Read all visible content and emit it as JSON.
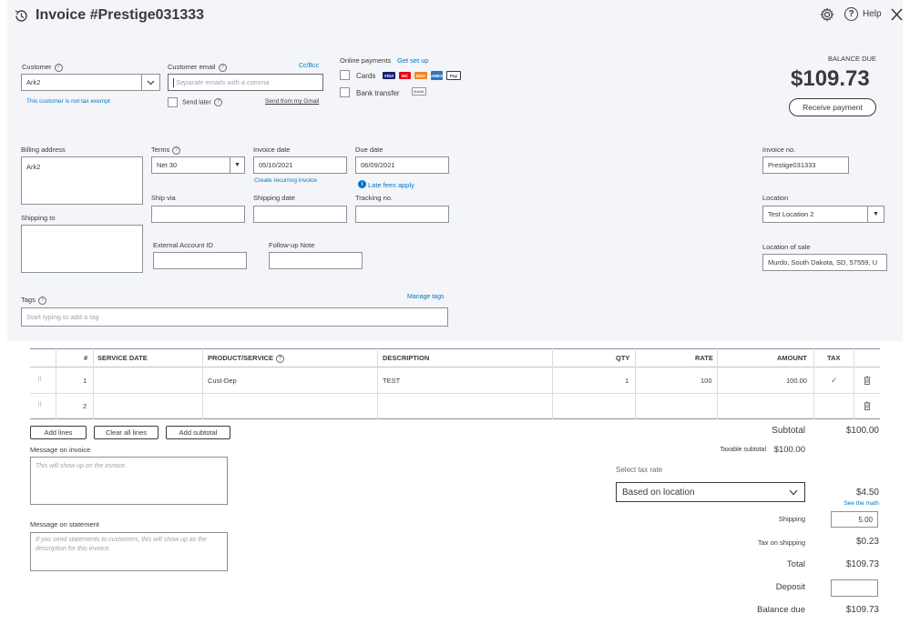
{
  "header": {
    "title": "Invoice #Prestige031333",
    "help_label": "Help"
  },
  "customer": {
    "label": "Customer",
    "value": "Ark2",
    "tax_note": "This customer is not tax exempt"
  },
  "email": {
    "label": "Customer email",
    "ccbcc": "Cc/Bcc",
    "placeholder": "Separate emails with a comma",
    "send_later": "Send later",
    "send_gmail": "Send from my Gmail"
  },
  "online_payments": {
    "label": "Online payments",
    "setup": "Get set up",
    "cards": "Cards",
    "bank": "Bank transfer",
    "card_logos": [
      "VISA",
      "MC",
      "DISC",
      "AMEX",
      "Pay"
    ],
    "bank_logo": "BANK"
  },
  "balance": {
    "label": "BALANCE DUE",
    "amount": "$109.73",
    "receive_button": "Receive payment"
  },
  "billing": {
    "label": "Billing address",
    "value": "Ark2",
    "shipping_label": "Shipping to"
  },
  "terms": {
    "label": "Terms",
    "value": "Net 30"
  },
  "invoice_date": {
    "label": "Invoice date",
    "value": "05/10/2021",
    "recurring": "Create recurring invoice"
  },
  "due_date": {
    "label": "Due date",
    "value": "06/09/2021",
    "late_fees": "Late fees apply"
  },
  "ship_via": {
    "label": "Ship via"
  },
  "shipping_date": {
    "label": "Shipping date"
  },
  "tracking": {
    "label": "Tracking no."
  },
  "external_id": {
    "label": "External Account ID"
  },
  "followup": {
    "label": "Follow-up Note"
  },
  "invoice_no": {
    "label": "Invoice no.",
    "value": "Prestige031333"
  },
  "location": {
    "label": "Location",
    "value": "Test Location 2"
  },
  "location_of_sale": {
    "label": "Location of sale",
    "value": "Murdo, South Dakota, SD, 57559, U"
  },
  "tags": {
    "label": "Tags",
    "manage": "Manage tags",
    "placeholder": "Start typing to add a tag"
  },
  "table": {
    "headers": {
      "num": "#",
      "service_date": "SERVICE DATE",
      "product": "PRODUCT/SERVICE",
      "description": "DESCRIPTION",
      "qty": "QTY",
      "rate": "RATE",
      "amount": "AMOUNT",
      "tax": "TAX"
    },
    "rows": [
      {
        "num": "1",
        "service_date": "",
        "product": "Cust-Dep",
        "description": "TEST",
        "qty": "1",
        "rate": "100",
        "amount": "100.00",
        "tax": "✓"
      },
      {
        "num": "2",
        "service_date": "",
        "product": "",
        "description": "",
        "qty": "",
        "rate": "",
        "amount": "",
        "tax": ""
      }
    ]
  },
  "actions": {
    "add_lines": "Add lines",
    "clear_lines": "Clear all lines",
    "add_subtotal": "Add subtotal"
  },
  "message_invoice": {
    "label": "Message on invoice",
    "placeholder": "This will show up on the invoice."
  },
  "message_statement": {
    "label": "Message on statement",
    "placeholder": "If you send statements to customers, this will show up as the description for this invoice."
  },
  "totals": {
    "subtotal_label": "Subtotal",
    "subtotal_value": "$100.00",
    "taxable_label": "Taxable subtotal",
    "taxable_value": "$100.00",
    "tax_rate_label": "Select tax rate",
    "tax_rate_value": "Based on location",
    "tax_value": "$4.50",
    "see_math": "See the math",
    "shipping_label": "Shipping",
    "shipping_value": "5.00",
    "tax_shipping_label": "Tax on shipping",
    "tax_shipping_value": "$0.23",
    "total_label": "Total",
    "total_value": "$109.73",
    "deposit_label": "Deposit",
    "balance_due_label": "Balance due",
    "balance_due_value": "$109.73"
  }
}
